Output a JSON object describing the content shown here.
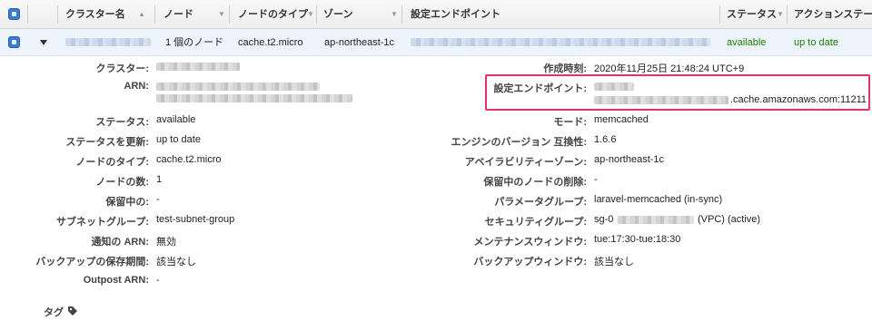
{
  "table": {
    "headers": {
      "cluster_name": "クラスター名",
      "nodes": "ノード",
      "node_type": "ノードのタイプ",
      "zone": "ゾーン",
      "endpoint": "設定エンドポイント",
      "status": "ステータス",
      "action_status": "アクションステー"
    },
    "row": {
      "nodes": "1 個のノード",
      "node_type": "cache.t2.micro",
      "zone": "ap-northeast-1c",
      "status": "available",
      "action_status": "up to date"
    }
  },
  "details": {
    "left": [
      {
        "label": "クラスター:",
        "value": ""
      },
      {
        "label": "ARN:",
        "value": ""
      },
      {
        "label": "ステータス:",
        "value": "available"
      },
      {
        "label": "ステータスを更新:",
        "value": "up to date"
      },
      {
        "label": "ノードのタイプ:",
        "value": "cache.t2.micro"
      },
      {
        "label": "ノードの数:",
        "value": "1"
      },
      {
        "label": "保留中の:",
        "value": "-"
      },
      {
        "label": "サブネットグループ:",
        "value": "test-subnet-group"
      },
      {
        "label": "通知の ARN:",
        "value": "無効"
      },
      {
        "label": "バックアップの保存期間:",
        "value": "該当なし"
      },
      {
        "label": "Outpost ARN:",
        "value": "-"
      }
    ],
    "right": [
      {
        "label": "作成時刻:",
        "value": "2020年11月25日 21:48:24 UTC+9"
      },
      {
        "label": "設定エンドポイント:",
        "value": ".cache.amazonaws.com:11211"
      },
      {
        "label": "モード:",
        "value": "memcached"
      },
      {
        "label": "エンジンのバージョン 互換性:",
        "value": "1.6.6"
      },
      {
        "label": "アベイラビリティーゾーン:",
        "value": "ap-northeast-1c"
      },
      {
        "label": "保留中のノードの削除:",
        "value": "-"
      },
      {
        "label": "パラメータグループ:",
        "value": "laravel-memcached (in-sync)"
      },
      {
        "label": "セキュリティグループ:",
        "value_prefix": "sg-0",
        "value": "(VPC) (active)"
      },
      {
        "label": "メンテナンスウィンドウ:",
        "value": "tue:17:30-tue:18:30"
      },
      {
        "label": "バックアップウィンドウ:",
        "value": "該当なし"
      }
    ],
    "tags_label": "タグ"
  },
  "colors": {
    "accent_blue": "#3a7bd5",
    "status_green": "#1d8102",
    "highlight_pink": "#e2336b"
  },
  "icons": {
    "sort": "sort-caret-icon",
    "expand": "expand-caret-icon",
    "tag": "tag-icon"
  }
}
